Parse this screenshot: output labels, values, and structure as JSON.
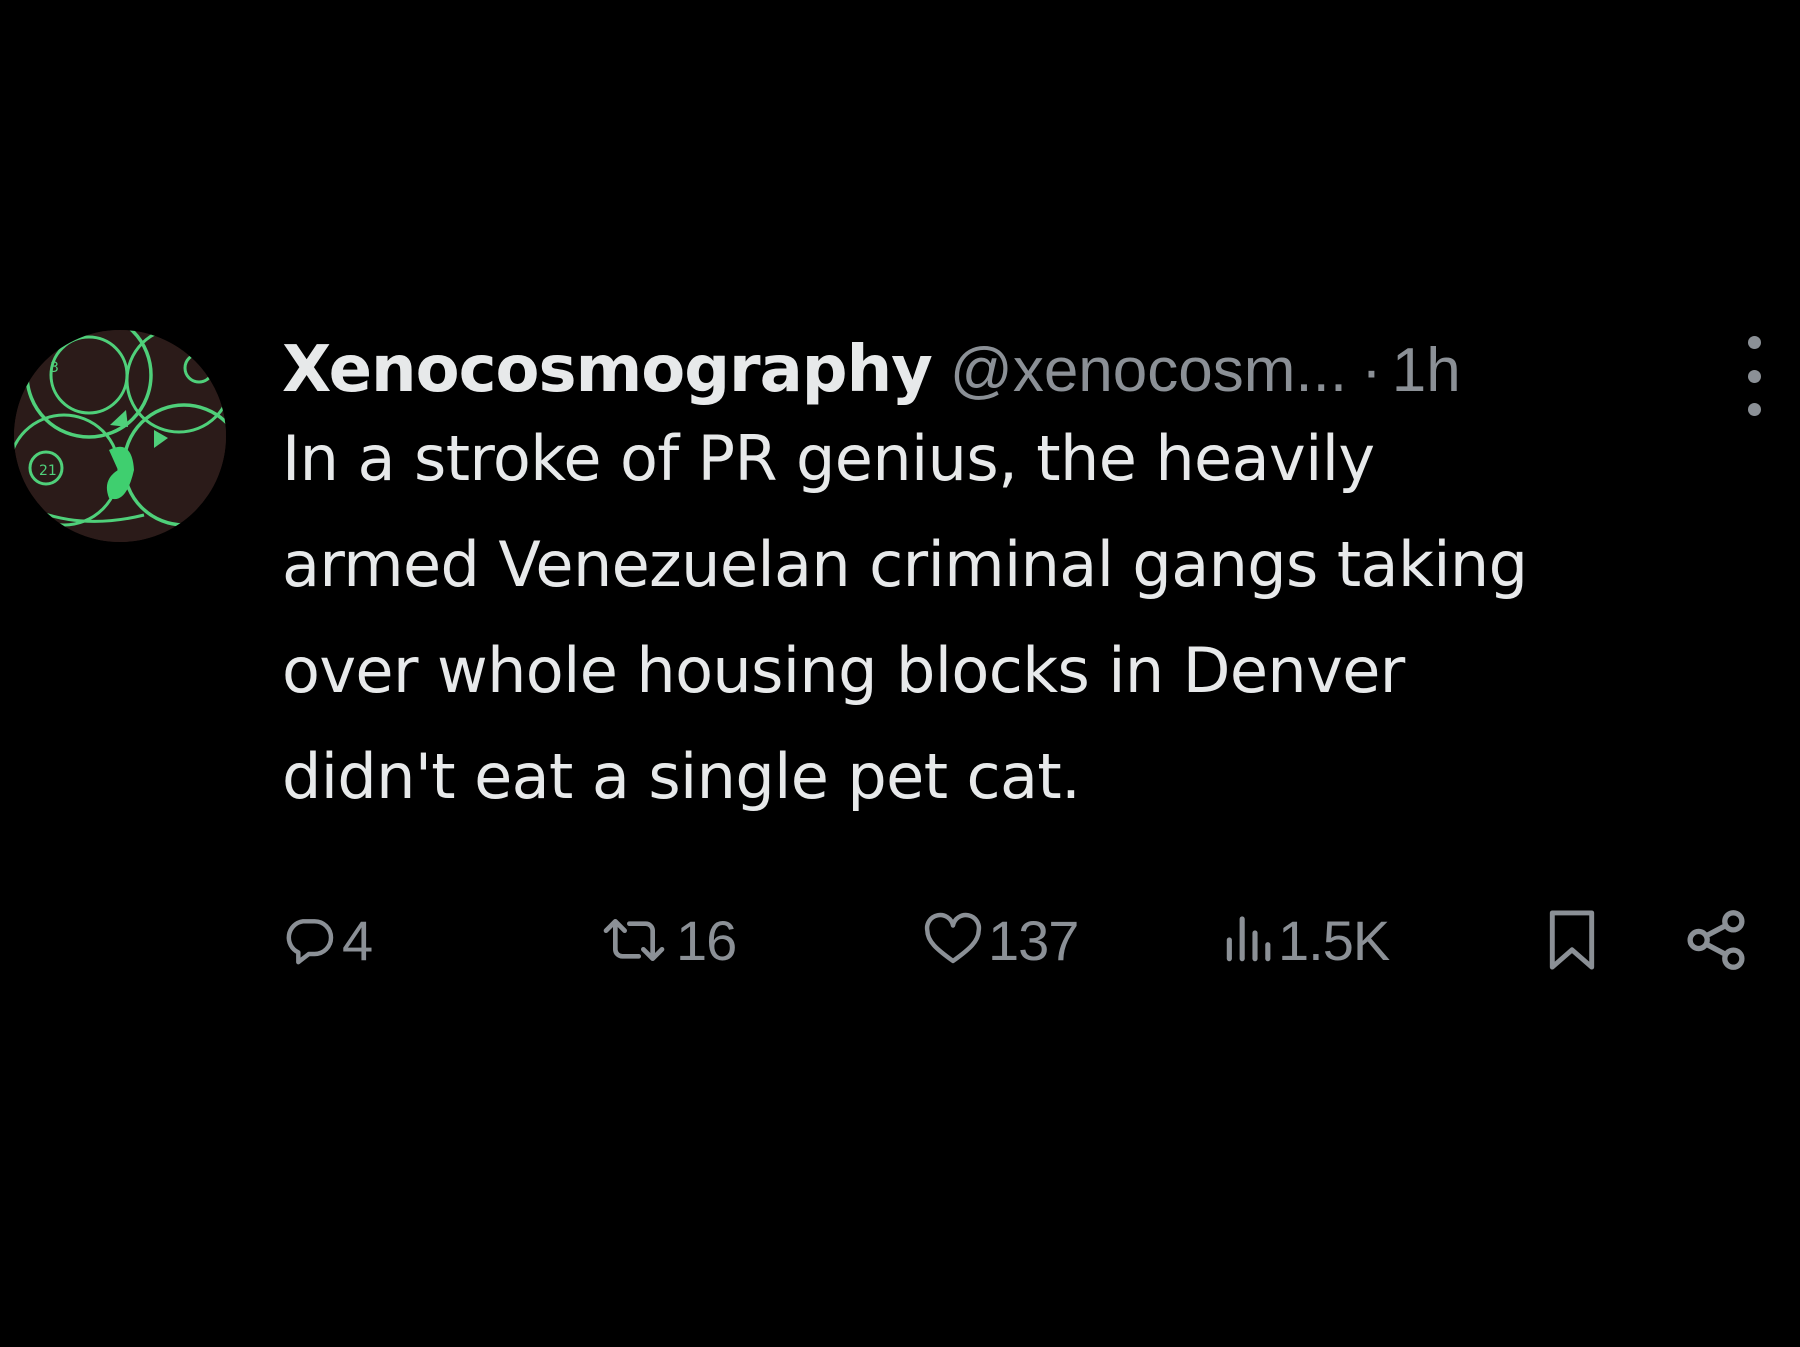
{
  "tweet": {
    "author": {
      "display_name": "Xenocosmography",
      "handle": "@xenocosm...",
      "separator": "·",
      "timestamp": "1h"
    },
    "text_lines": [
      "In a stroke of PR genius, the heavily",
      "armed Venezuelan criminal gangs taking",
      "over whole housing blocks in Denver",
      "didn't eat a single pet cat."
    ],
    "actions": {
      "replies": "4",
      "reposts": "16",
      "likes": "137",
      "views": "1.5K"
    },
    "icons": {
      "more": "more-vertical-icon",
      "reply": "reply-icon",
      "repost": "repost-icon",
      "like": "heart-icon",
      "views": "views-icon",
      "bookmark": "bookmark-icon",
      "share": "share-icon"
    },
    "colors": {
      "background": "#000000",
      "text": "#e7e9ea",
      "secondary": "#8b9096",
      "avatar_accent": "#4fd07a"
    }
  }
}
